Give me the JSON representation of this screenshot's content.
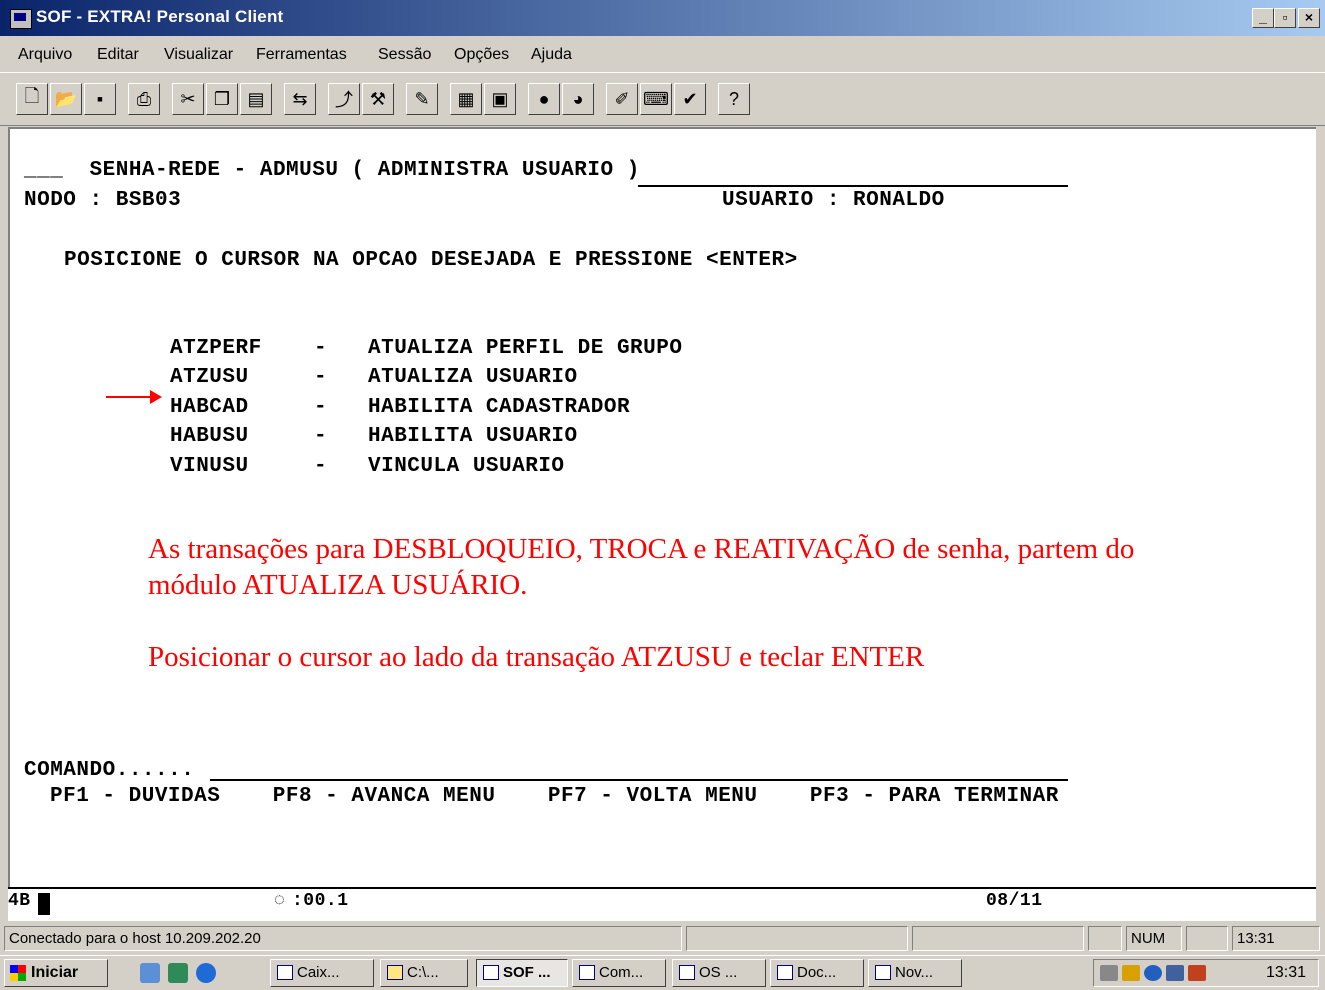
{
  "window": {
    "title": "SOF - EXTRA! Personal Client"
  },
  "menu": [
    "Arquivo",
    "Editar",
    "Visualizar",
    "Ferramentas",
    "Sessão",
    "Opções",
    "Ajuda"
  ],
  "toolbar_icons": [
    "new-icon",
    "open-icon",
    "save-icon",
    "print-icon",
    "cut-icon",
    "copy-icon",
    "paste-icon",
    "send-icon",
    "transfer-icon",
    "tools-icon",
    "macro-icon",
    "session-icon",
    "config-icon",
    "record-icon",
    "color-icon",
    "edit-icon",
    "keyboard-icon",
    "check-icon",
    "help-icon"
  ],
  "terminal": {
    "header_title": "___  SENHA-REDE - ADMUSU ( ADMINISTRA USUARIO )",
    "nodo": "NODO : BSB03",
    "usuario": "USUARIO : RONALDO",
    "instruction": "POSICIONE O CURSOR NA OPCAO DESEJADA E PRESSIONE <ENTER>",
    "options": [
      {
        "code": "ATZPERF",
        "sep": "-",
        "desc": "ATUALIZA PERFIL DE GRUPO"
      },
      {
        "code": "ATZUSU",
        "sep": "-",
        "desc": "ATUALIZA USUARIO"
      },
      {
        "code": "HABCAD",
        "sep": "-",
        "desc": "HABILITA CADASTRADOR"
      },
      {
        "code": "HABUSU",
        "sep": "-",
        "desc": "HABILITA USUARIO"
      },
      {
        "code": "VINUSU",
        "sep": "-",
        "desc": "VINCULA USUARIO"
      }
    ],
    "annotation_line1": "As transações para DESBLOQUEIO, TROCA e REATIVAÇÃO de senha, partem do",
    "annotation_line2": "módulo ATUALIZA USUÁRIO.",
    "annotation_line3": "Posicionar o cursor ao lado da transação ATZUSU e teclar ENTER",
    "comando_label": "COMANDO......",
    "pf_keys": "PF1 - DUVIDAS    PF8 - AVANCA MENU    PF7 - VOLTA MENU    PF3 - PARA TERMINAR"
  },
  "oia": {
    "indicator": "4B",
    "timer": ":00.1",
    "cursor_pos": "08/11"
  },
  "statusbar": {
    "message": "Conectado para o host 10.209.202.20",
    "num": "NUM",
    "time": "13:31"
  },
  "taskbar": {
    "start": "Iniciar",
    "tasks": [
      "Caix...",
      "C:\\...",
      "SOF ...",
      "Com...",
      "OS ...",
      "Doc...",
      "Nov..."
    ],
    "clock": "13:31"
  },
  "colors": {
    "annotation": "#ff0000",
    "titlebar_start": "#0a246a",
    "titlebar_end": "#a6caf0"
  }
}
